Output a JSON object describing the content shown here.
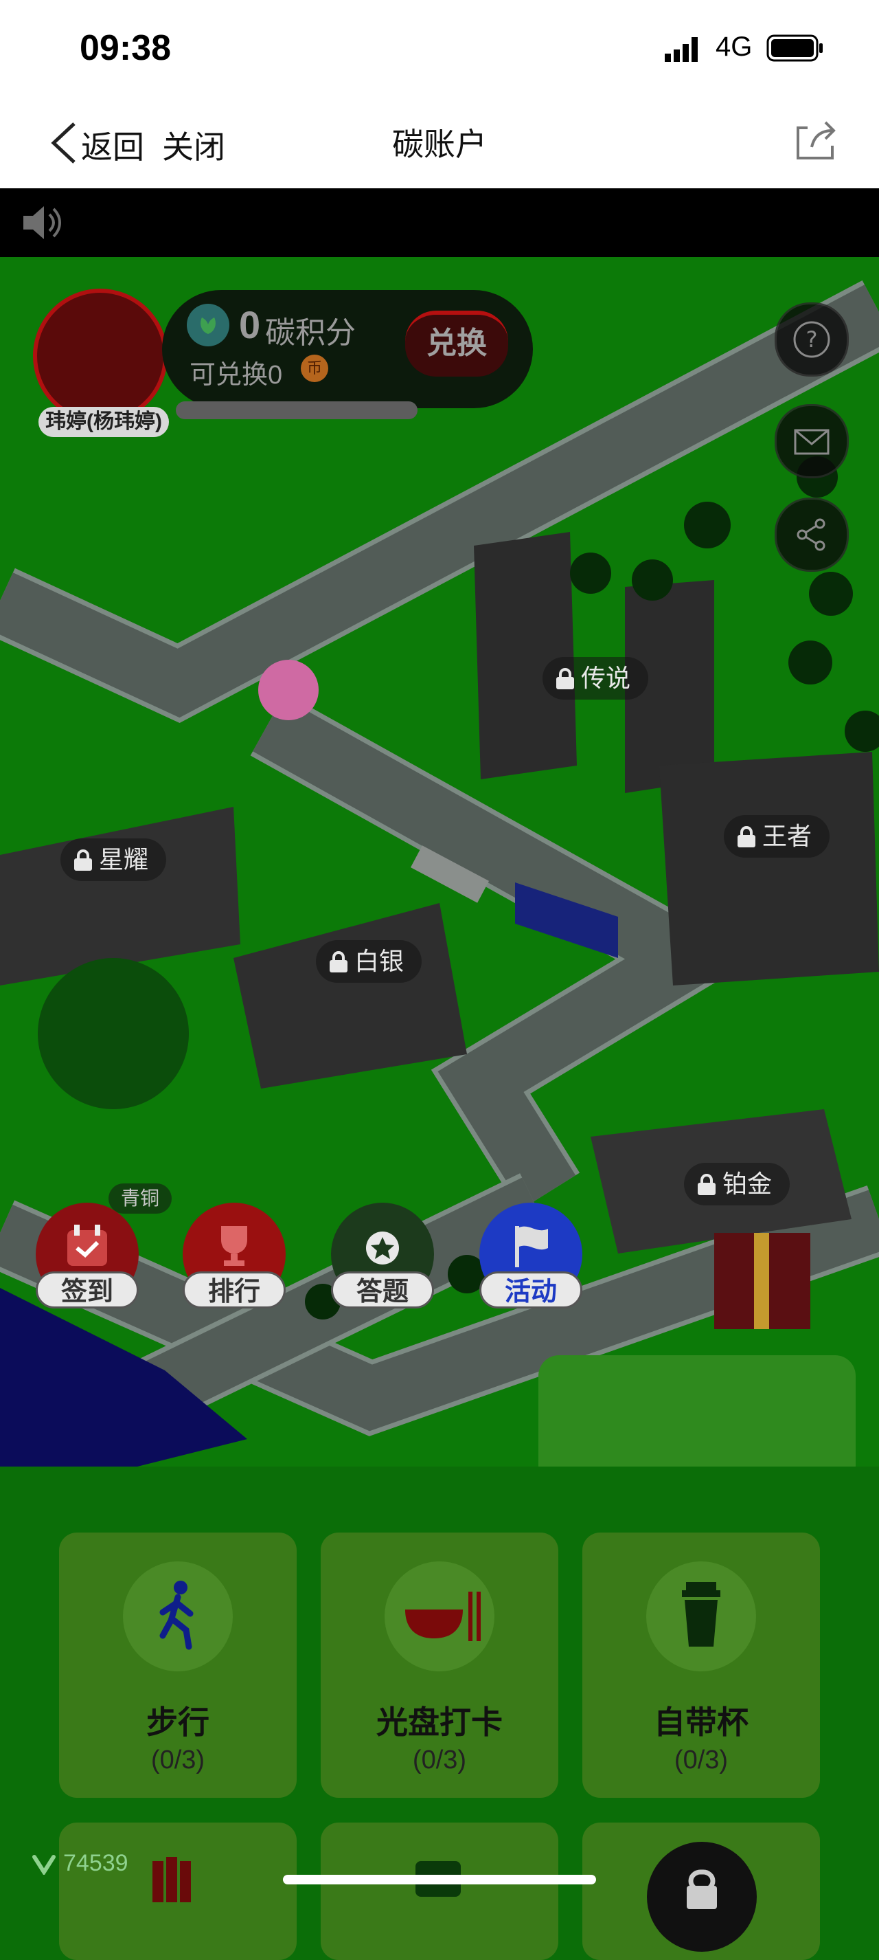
{
  "status": {
    "time": "09:38",
    "network": "4G"
  },
  "nav": {
    "back_label": "返回",
    "close_label": "关闭",
    "title": "碳账户"
  },
  "profile": {
    "name": "玮婷(杨玮婷)",
    "points_value": "0",
    "points_label": "碳积分",
    "exchange_label": "可兑换0",
    "coin_label": "币",
    "exchange_button": "兑换"
  },
  "buildings": {
    "legend": "传说",
    "king": "王者",
    "star": "星耀",
    "silver": "白银",
    "platinum": "铂金",
    "bronze": "青铜"
  },
  "features": [
    {
      "label": "签到"
    },
    {
      "label": "排行"
    },
    {
      "label": "答题"
    },
    {
      "label": "活动"
    }
  ],
  "tasks": [
    {
      "title": "步行",
      "count": "(0/3)"
    },
    {
      "title": "光盘打卡",
      "count": "(0/3)"
    },
    {
      "title": "自带杯",
      "count": "(0/3)"
    }
  ],
  "footer": {
    "likes": "74539"
  },
  "colors": {
    "grass": "#0c7a08",
    "road": "#5a6660",
    "accent_red": "#c3101b",
    "accent_blue": "#1d3ac4"
  }
}
